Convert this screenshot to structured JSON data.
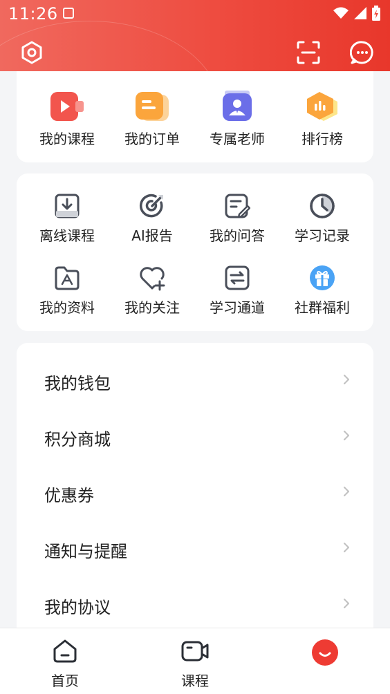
{
  "status_bar": {
    "time": "11:26"
  },
  "top_grid": [
    {
      "label": "我的课程",
      "icon": "video-icon"
    },
    {
      "label": "我的订单",
      "icon": "order-icon"
    },
    {
      "label": "专属老师",
      "icon": "teacher-icon"
    },
    {
      "label": "排行榜",
      "icon": "ranking-icon"
    }
  ],
  "tools_grid": [
    {
      "label": "离线课程",
      "icon": "download-icon"
    },
    {
      "label": "AI报告",
      "icon": "target-icon"
    },
    {
      "label": "我的问答",
      "icon": "qa-icon"
    },
    {
      "label": "学习记录",
      "icon": "clock-icon"
    },
    {
      "label": "我的资料",
      "icon": "folder-icon"
    },
    {
      "label": "我的关注",
      "icon": "heart-icon"
    },
    {
      "label": "学习通道",
      "icon": "swap-icon"
    },
    {
      "label": "社群福利",
      "icon": "gift-icon"
    }
  ],
  "menu": [
    {
      "label": "我的钱包"
    },
    {
      "label": "积分商城"
    },
    {
      "label": "优惠券"
    },
    {
      "label": "通知与提醒"
    },
    {
      "label": "我的协议"
    }
  ],
  "bottom_nav": [
    {
      "label": "首页",
      "icon": "home-icon"
    },
    {
      "label": "课程",
      "icon": "video-camera-icon"
    },
    {
      "label": "",
      "icon": "profile-face-icon"
    }
  ],
  "colors": {
    "accent": "#ee4c40",
    "icon_gray": "#4a4f5a",
    "chevron": "#c0c0c0"
  }
}
